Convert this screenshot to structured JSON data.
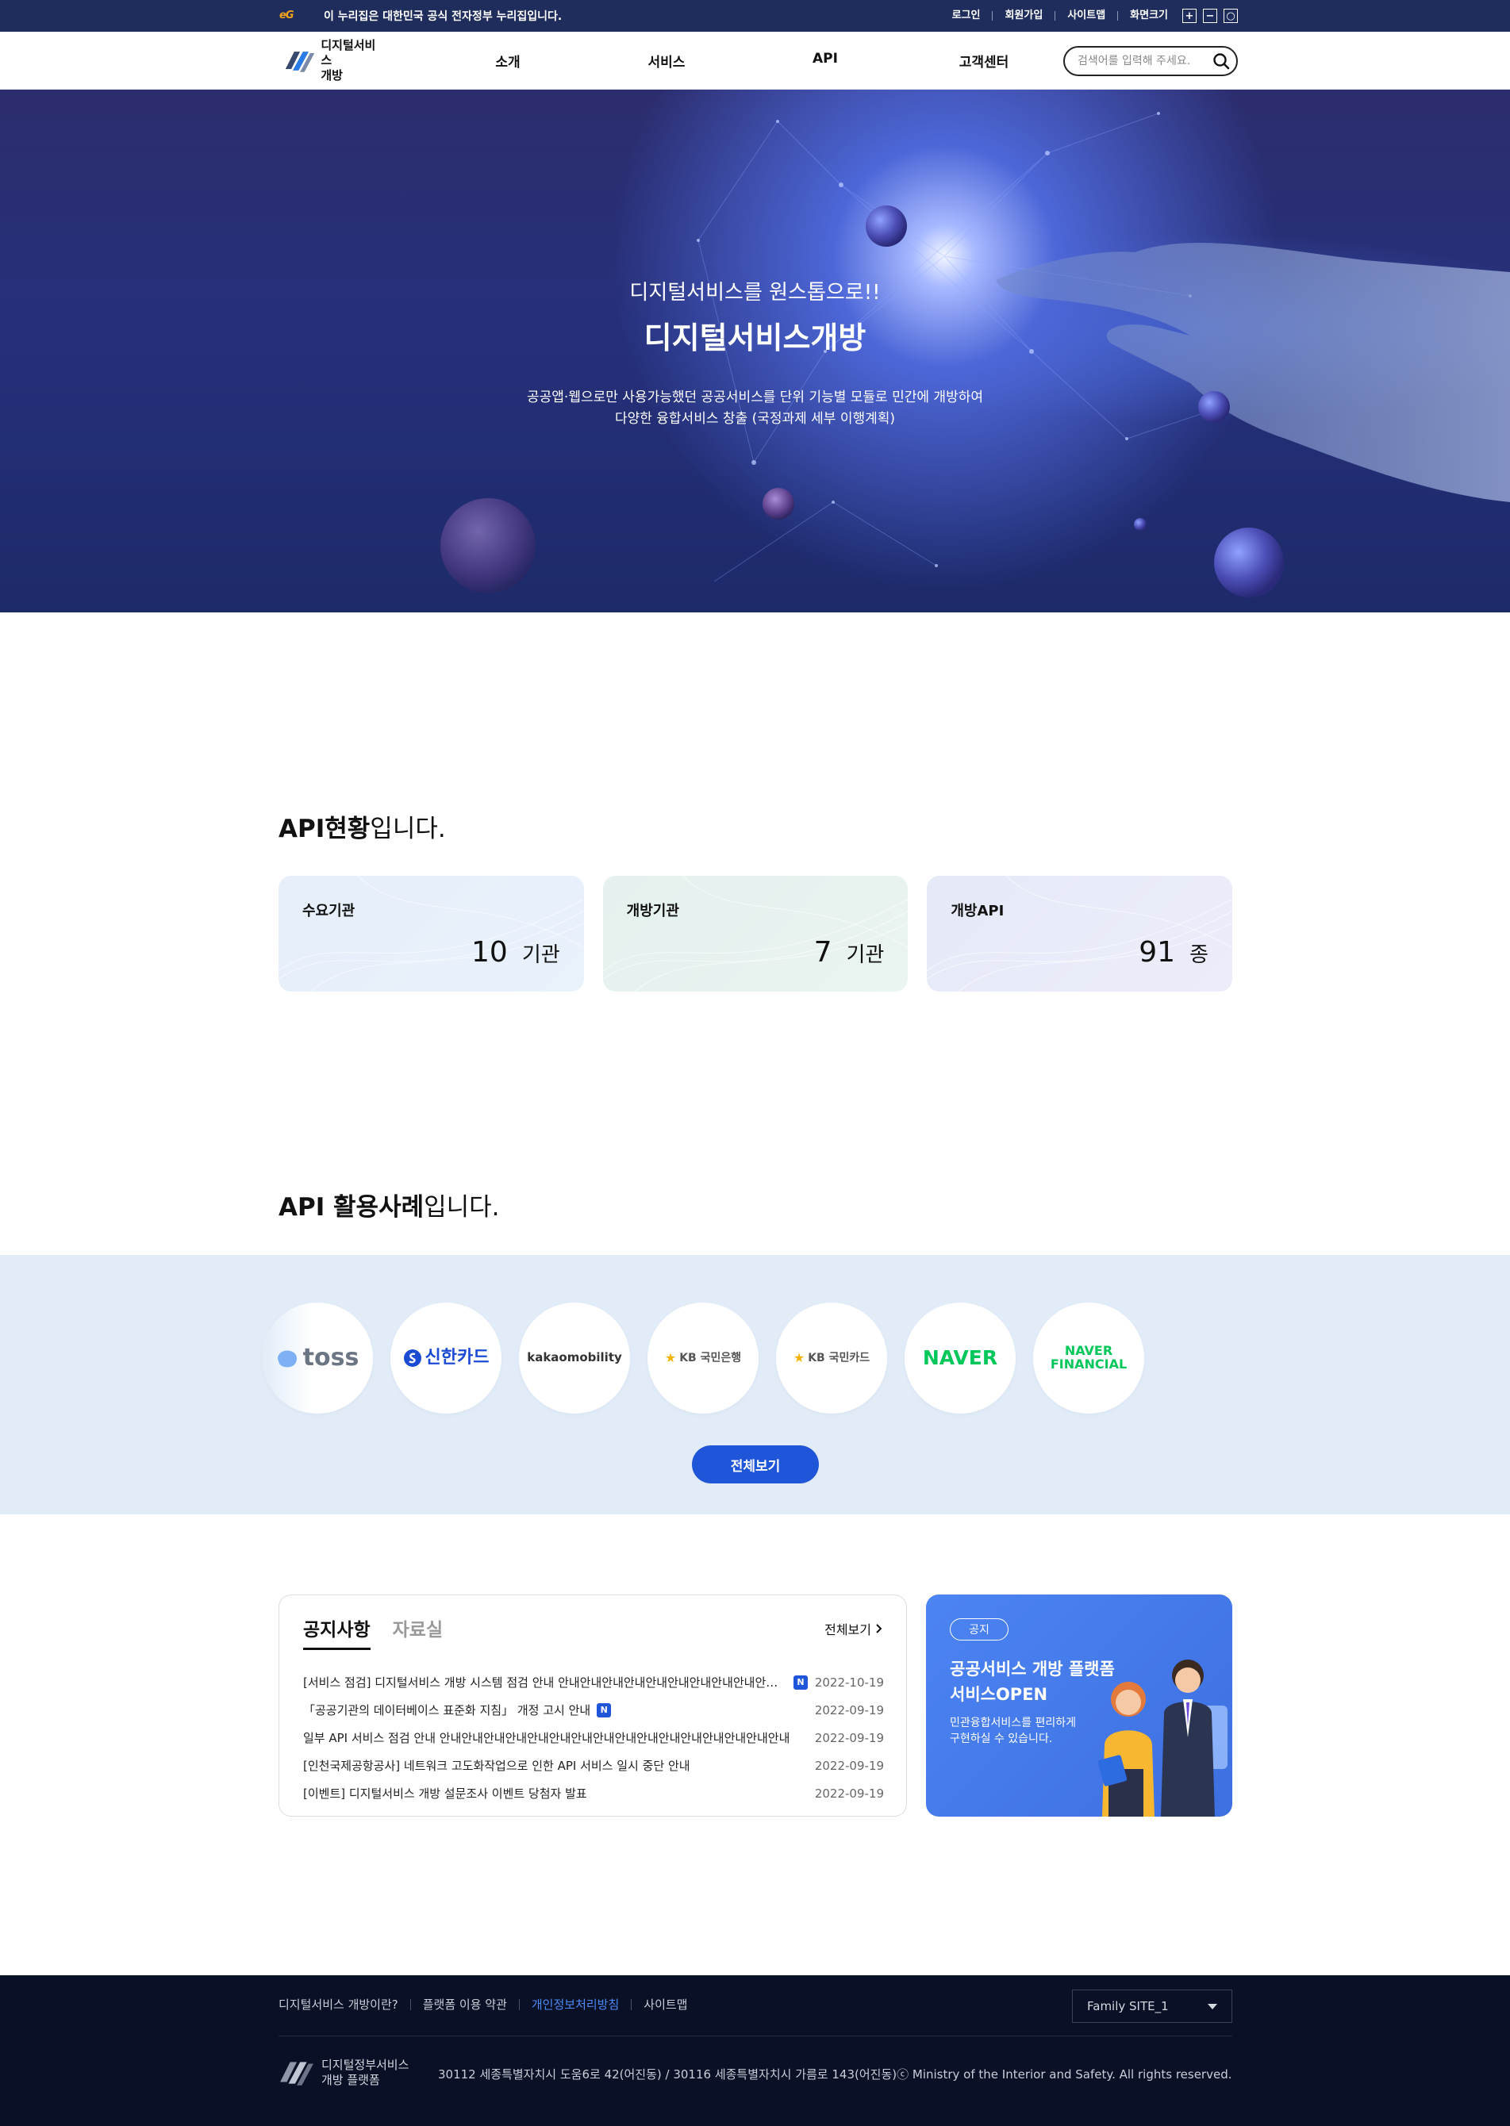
{
  "govbar": {
    "eg_logo": "eG",
    "notice": "이 누리집은 대한민국 공식 전자정부 누리집입니다.",
    "links": [
      "로그인",
      "회원가입",
      "사이트맵",
      "화면크기"
    ],
    "zoom_in": "+",
    "zoom_out": "−",
    "zoom_reset": "○"
  },
  "header": {
    "brand_line1": "디지털서비스",
    "brand_line2": "개방",
    "nav": [
      "소개",
      "서비스",
      "API",
      "고객센터"
    ],
    "search_placeholder": "검색어를 입력해 주세요."
  },
  "hero": {
    "subtitle": "디지털서비스를 원스톱으로!!",
    "title": "디지털서비스개방",
    "desc_line1": "공공앱·웹으로만 사용가능했던 공공서비스를 단위 기능별 모듈로 민간에 개방하여",
    "desc_line2": "다양한 융합서비스 창출 (국정과제 세부 이행계획)"
  },
  "api_status": {
    "title_bold": "API현황",
    "title_rest": "입니다.",
    "cards": [
      {
        "label": "수요기관",
        "value": "10",
        "unit": "기관"
      },
      {
        "label": "개방기관",
        "value": "7",
        "unit": "기관"
      },
      {
        "label": "개방API",
        "value": "91",
        "unit": "종"
      }
    ]
  },
  "api_cases": {
    "title_bold": "API 활용사례",
    "title_rest": "입니다.",
    "logos": [
      "toss",
      "신한카드",
      "kakaomobility",
      "KB 국민은행",
      "KB 국민카드",
      "NAVER",
      "NAVER FINANCIAL"
    ],
    "view_all": "전체보기"
  },
  "notice": {
    "tabs": [
      "공지사항",
      "자료실"
    ],
    "more": "전체보기",
    "new_badge": "N",
    "items": [
      {
        "title": "[서비스 점검] 디지털서비스 개방 시스템 점검 안내 안내안내안내안내안내안내안내안내안내안내안내",
        "date": "2022-10-19",
        "new": true
      },
      {
        "title": "「공공기관의 데이터베이스 표준화 지침」 개정 고시 안내",
        "date": "2022-09-19",
        "new": true
      },
      {
        "title": "일부 API 서비스 점검 안내 안내안내안내안내안내안내안내안내안내안내안내안내안내안내안내안내",
        "date": "2022-09-19",
        "new": false
      },
      {
        "title": "[인천국제공항공사] 네트워크 고도화작업으로 인한 API 서비스 일시 중단 안내",
        "date": "2022-09-19",
        "new": false
      },
      {
        "title": "[이벤트] 디지털서비스 개방 설문조사 이벤트 당첨자 발표",
        "date": "2022-09-19",
        "new": false
      }
    ]
  },
  "banner": {
    "tag": "공지",
    "headline_1": "공공서비스 개방 플랫폼",
    "headline_2": "서비스OPEN",
    "desc_1": "민관융합서비스를 편리하게",
    "desc_2": "구현하실 수 있습니다."
  },
  "footer": {
    "links": [
      "디지털서비스 개방이란?",
      "플랫폼 이용 약관",
      "개인정보처리방침",
      "사이트맵"
    ],
    "family_site": "Family SITE_1",
    "brand_line1": "디지털정부서비스",
    "brand_line2": "개방 플랫폼",
    "address": "30112 세종특별자치시 도움6로 42(어진동) / 30116 세종특별자치시 가름로 143(어진동)ⓒ Ministry of the Interior and Safety. All rights reserved."
  },
  "colors": {
    "govbar_bg": "#1f2d5c",
    "accent": "#1f55d8",
    "cases_bg": "#e1ecf8",
    "footer_bg": "#0a1126",
    "link_highlight": "#4c8af7"
  }
}
